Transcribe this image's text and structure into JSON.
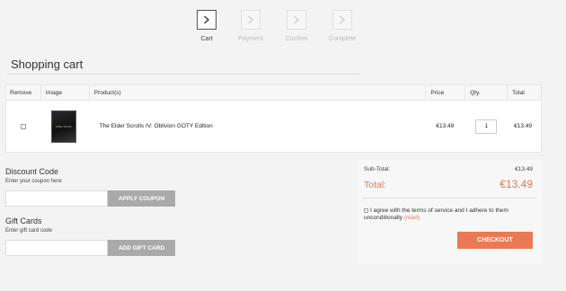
{
  "steps": [
    {
      "label": "Cart",
      "icon": "chevron-right-icon",
      "state": "active"
    },
    {
      "label": "Payment",
      "icon": "chevron-right-icon",
      "state": "disabled"
    },
    {
      "label": "Confirm",
      "icon": "chevron-right-icon",
      "state": "disabled"
    },
    {
      "label": "Complete",
      "icon": "chevron-right-icon",
      "state": "disabled"
    }
  ],
  "page_title": "Shopping cart",
  "table": {
    "headers": {
      "remove": "Remove",
      "image": "Image",
      "product": "Product(s)",
      "price": "Price",
      "qty": "Qty.",
      "total": "Total"
    },
    "rows": [
      {
        "product": "The Elder Scrolls IV: Oblivion GOTY Edition",
        "cover_text": "OBLIVION",
        "price": "€13.49",
        "qty": "1",
        "total": "€13.49",
        "remove_checked": false
      }
    ]
  },
  "discount": {
    "title": "Discount Code",
    "subtitle": "Enter your coupon here",
    "input_value": "",
    "button": "APPLY COUPON"
  },
  "gift": {
    "title": "Gift Cards",
    "subtitle": "Enter gift card code",
    "input_value": "",
    "button": "ADD GIFT CARD"
  },
  "totals": {
    "subtotal_label": "Sub-Total:",
    "subtotal_value": "€13.49",
    "total_label": "Total:",
    "total_value": "€13.49",
    "terms_text": "I agree with the terms of service and I adhere to them unconditionally",
    "terms_link": "(read)",
    "terms_checked": false,
    "checkout_button": "CHECKOUT"
  },
  "colors": {
    "accent": "#ea7a55",
    "total_text": "#e07a52",
    "gray_button": "#a9a9a9",
    "background": "#f3f3f3"
  }
}
